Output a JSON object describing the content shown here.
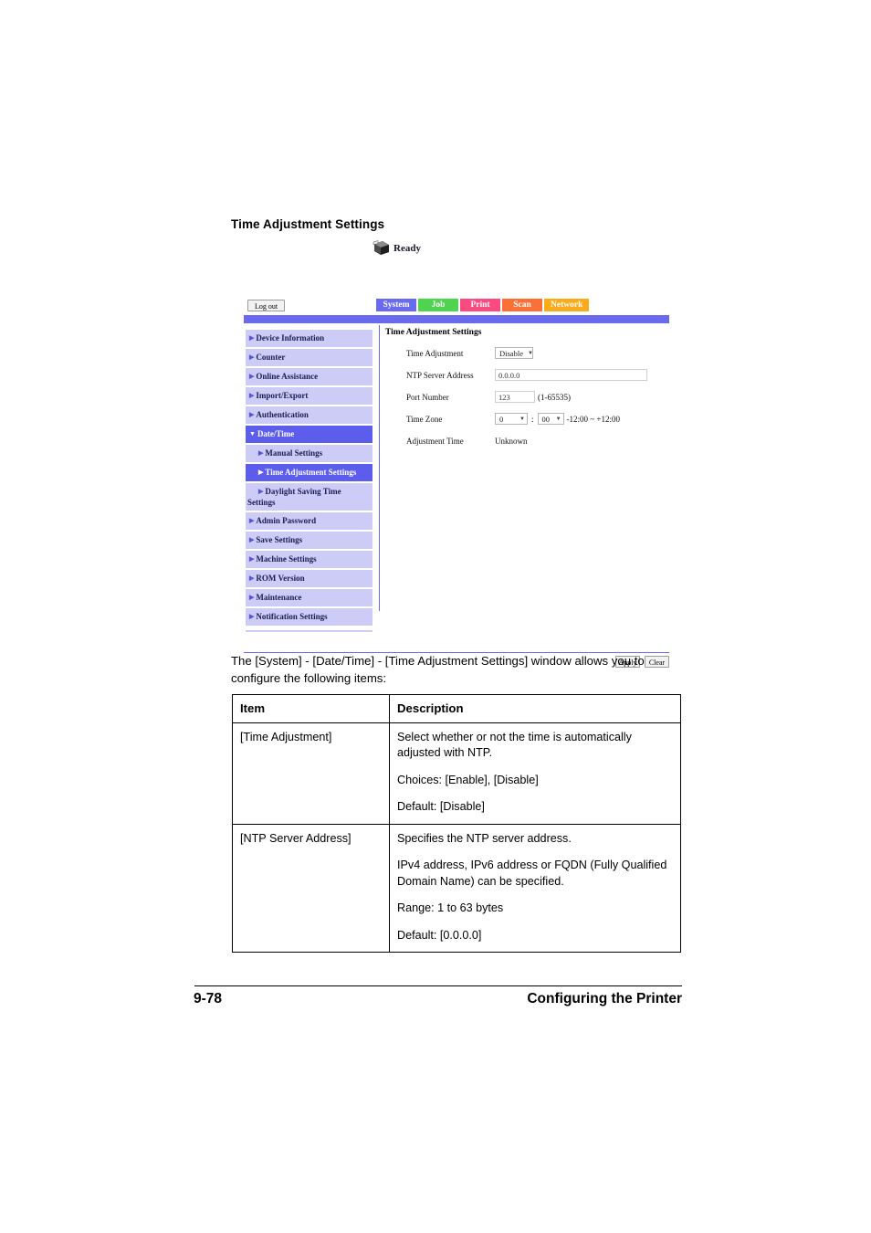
{
  "page": {
    "heading": "Time Adjustment Settings"
  },
  "status": {
    "icon": "printer-icon",
    "text": "Ready"
  },
  "webui": {
    "logout_label": "Log out",
    "tabs": [
      {
        "label": "System",
        "color": "#6a6aee"
      },
      {
        "label": "Job",
        "color": "#4fd44f"
      },
      {
        "label": "Print",
        "color": "#fa4a80"
      },
      {
        "label": "Scan",
        "color": "#fb7036"
      },
      {
        "label": "Network",
        "color": "#fbab1a"
      }
    ],
    "sidebar": [
      {
        "label": "Device Information",
        "state": "normal"
      },
      {
        "label": "Counter",
        "state": "normal"
      },
      {
        "label": "Online Assistance",
        "state": "normal"
      },
      {
        "label": "Import/Export",
        "state": "normal"
      },
      {
        "label": "Authentication",
        "state": "normal"
      },
      {
        "label": "Date/Time",
        "state": "expanded"
      },
      {
        "label": "Manual Settings",
        "state": "sub"
      },
      {
        "label": "Time Adjustment Settings",
        "state": "sub-active"
      },
      {
        "label": "Daylight Saving Time Settings",
        "state": "sub-wrap"
      },
      {
        "label": "Admin Password",
        "state": "normal"
      },
      {
        "label": "Save Settings",
        "state": "normal"
      },
      {
        "label": "Machine Settings",
        "state": "normal"
      },
      {
        "label": "ROM Version",
        "state": "normal"
      },
      {
        "label": "Maintenance",
        "state": "normal"
      },
      {
        "label": "Notification Settings",
        "state": "normal"
      }
    ],
    "content": {
      "title": "Time Adjustment Settings",
      "fields": {
        "time_adjustment_label": "Time Adjustment",
        "time_adjustment_value": "Disable",
        "ntp_server_label": "NTP Server Address",
        "ntp_server_value": "0.0.0.0",
        "port_number_label": "Port Number",
        "port_number_value": "123",
        "port_number_hint": "(1-65535)",
        "time_zone_label": "Time Zone",
        "time_zone_hours": "0",
        "time_zone_separator": ":",
        "time_zone_minutes": "00",
        "time_zone_hint": "-12:00 ~ +12:00",
        "adjustment_time_label": "Adjustment Time",
        "adjustment_time_value": "Unknown"
      }
    },
    "actions": {
      "apply_label": "Apply",
      "clear_label": "Clear"
    }
  },
  "body": {
    "paragraph": "The [System] - [Date/Time] - [Time Adjustment Settings] window allows you to configure the following items:"
  },
  "table": {
    "headers": [
      "Item",
      "Description"
    ],
    "rows": [
      {
        "item": "[Time Adjustment]",
        "description": [
          "Select whether or not the time is automatically adjusted with NTP.",
          "Choices: [Enable], [Disable]",
          "Default:  [Disable]"
        ]
      },
      {
        "item": "[NTP Server Address]",
        "description": [
          "Specifies the NTP server address.",
          "IPv4 address, IPv6 address or FQDN (Fully Qualified Domain Name) can be specified.",
          "Range:   1 to 63 bytes",
          "Default:  [0.0.0.0]"
        ]
      }
    ]
  },
  "footer": {
    "page_number": "9-78",
    "section": "Configuring the Printer"
  }
}
